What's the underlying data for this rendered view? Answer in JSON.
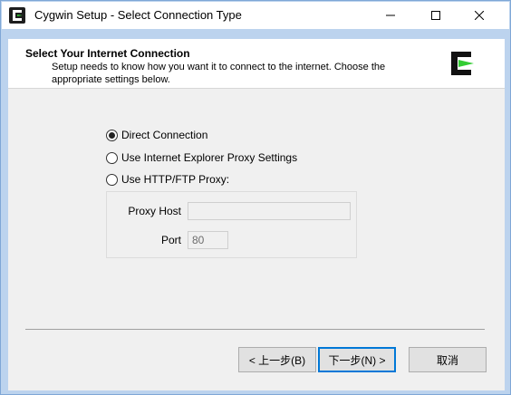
{
  "window": {
    "title": "Cygwin Setup - Select Connection Type"
  },
  "icons": {
    "app": "cygwin-icon",
    "minimize": "minimize-icon",
    "maximize": "maximize-icon",
    "close": "close-icon",
    "logo": "cygwin-logo"
  },
  "header": {
    "title": "Select Your Internet Connection",
    "description": "Setup needs to know how you want it to connect to the internet.  Choose the appropriate settings below."
  },
  "options": {
    "direct": {
      "label": "Direct Connection",
      "selected": true
    },
    "ie_proxy": {
      "label": "Use Internet Explorer Proxy Settings",
      "selected": false
    },
    "http_proxy": {
      "label": "Use HTTP/FTP Proxy:",
      "selected": false
    }
  },
  "proxy": {
    "host_label": "Proxy Host",
    "host_value": "",
    "port_label": "Port",
    "port_value": "80"
  },
  "buttons": {
    "back": "< 上一步(B)",
    "next": "下一步(N) >",
    "cancel": "取消"
  },
  "colors": {
    "accent": "#0078d7",
    "logo_green": "#33cc33"
  }
}
